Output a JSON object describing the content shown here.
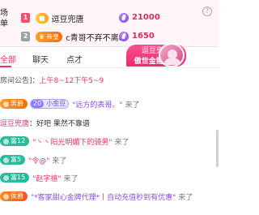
{
  "rank_panel": {
    "side_line1": "场",
    "side_line2": "单",
    "rows": [
      {
        "rank": "1",
        "badge": "",
        "name": "逗豆兜唐",
        "coins": "21000"
      },
      {
        "rank": "2",
        "badge": "帝皇",
        "name": "c青哥不弃不离c",
        "coins": "1650"
      }
    ],
    "help_icon": "?"
  },
  "host_banner": {
    "name": "逗豆兜唐",
    "subtitle": "傲世金箍 1个"
  },
  "tabs": [
    {
      "label": "全部"
    },
    {
      "label": "聊天"
    },
    {
      "label": "点才"
    }
  ],
  "announcement": {
    "prefix": "房间公告]：",
    "hours": "上午8~12下午5~9"
  },
  "messages": [
    {
      "badge": "男爵",
      "fan_level": "20",
      "fan_name": "小金豆",
      "user": "\"远方的表哥。\"",
      "action": "来了"
    },
    {
      "name": "逗豆兜唐",
      "text": "：好吧 果然不靠谱"
    },
    {
      "badge": "富12",
      "user": "\"丶丶阳光明媚下的骑男\"",
      "action": "来了"
    },
    {
      "badge": "富5",
      "user": "\"令@\"",
      "action": "来了"
    },
    {
      "badge": "富15",
      "user": "\"赵字禧\"",
      "action": "来了"
    },
    {
      "badge": "侯爵",
      "user": "\"*客家甜心金牌代理*丨自动充值秒到有优惠\"",
      "action": "来了"
    }
  ],
  "colors": {
    "accent": "#e8336b",
    "banner": "#ff4f8f",
    "coin": "#7b3fe4"
  },
  "icons": [
    "coin-icon",
    "help-icon",
    "host-avatar"
  ]
}
